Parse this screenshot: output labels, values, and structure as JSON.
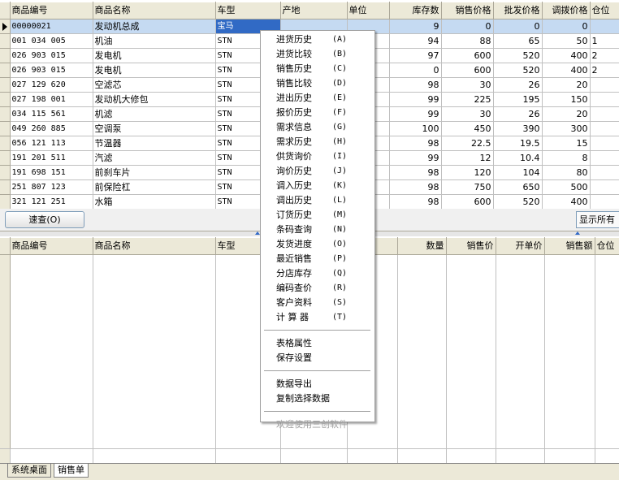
{
  "top_grid": {
    "headers": [
      "商品编号",
      "商品名称",
      "车型",
      "产地",
      "单位",
      "库存数",
      "销售价格",
      "批发价格",
      "调拨价格",
      "仓位"
    ],
    "rows": [
      {
        "code": "00000021",
        "name": "发动机总成",
        "model": "宝马",
        "origin": "",
        "unit": "",
        "stock": "9",
        "sale": "0",
        "wholesale": "0",
        "transfer": "0",
        "bin": ""
      },
      {
        "code": "001 034 005",
        "name": "机油",
        "model": "STN",
        "origin": "",
        "unit": "",
        "stock": "94",
        "sale": "88",
        "wholesale": "65",
        "transfer": "50",
        "bin": "1"
      },
      {
        "code": "026 903 015",
        "name": "发电机",
        "model": "STN",
        "origin": "",
        "unit": "",
        "stock": "97",
        "sale": "600",
        "wholesale": "520",
        "transfer": "400",
        "bin": "2"
      },
      {
        "code": "026 903 015",
        "name": "发电机",
        "model": "STN",
        "origin": "",
        "unit": "",
        "stock": "0",
        "sale": "600",
        "wholesale": "520",
        "transfer": "400",
        "bin": "2"
      },
      {
        "code": "027 129 620",
        "name": "空滤芯",
        "model": "STN",
        "origin": "",
        "unit": "",
        "stock": "98",
        "sale": "30",
        "wholesale": "26",
        "transfer": "20",
        "bin": ""
      },
      {
        "code": "027 198 001",
        "name": "发动机大修包",
        "model": "STN",
        "origin": "",
        "unit": "",
        "stock": "99",
        "sale": "225",
        "wholesale": "195",
        "transfer": "150",
        "bin": ""
      },
      {
        "code": "034 115 561",
        "name": "机滤",
        "model": "STN",
        "origin": "",
        "unit": "",
        "stock": "99",
        "sale": "30",
        "wholesale": "26",
        "transfer": "20",
        "bin": ""
      },
      {
        "code": "049 260 885",
        "name": "空调泵",
        "model": "STN",
        "origin": "",
        "unit": "",
        "stock": "100",
        "sale": "450",
        "wholesale": "390",
        "transfer": "300",
        "bin": ""
      },
      {
        "code": "056 121 113",
        "name": "节温器",
        "model": "STN",
        "origin": "",
        "unit": "",
        "stock": "98",
        "sale": "22.5",
        "wholesale": "19.5",
        "transfer": "15",
        "bin": ""
      },
      {
        "code": "191 201 511",
        "name": "汽滤",
        "model": "STN",
        "origin": "",
        "unit": "",
        "stock": "99",
        "sale": "12",
        "wholesale": "10.4",
        "transfer": "8",
        "bin": ""
      },
      {
        "code": "191 698 151",
        "name": "前刹车片",
        "model": "STN",
        "origin": "",
        "unit": "",
        "stock": "98",
        "sale": "120",
        "wholesale": "104",
        "transfer": "80",
        "bin": ""
      },
      {
        "code": "251 807 123",
        "name": "前保险杠",
        "model": "STN",
        "origin": "",
        "unit": "",
        "stock": "98",
        "sale": "750",
        "wholesale": "650",
        "transfer": "500",
        "bin": ""
      },
      {
        "code": "321 121 251",
        "name": "水箱",
        "model": "STN",
        "origin": "",
        "unit": "",
        "stock": "98",
        "sale": "600",
        "wholesale": "520",
        "transfer": "400",
        "bin": ""
      }
    ]
  },
  "toolbar": {
    "quick_search_label": "速查(O)",
    "show_all_label": "显示所有"
  },
  "bottom_grid": {
    "headers": [
      "商品编号",
      "商品名称",
      "车型",
      "",
      "",
      "数量",
      "销售价",
      "开单价",
      "销售额",
      "仓位"
    ]
  },
  "tabs": [
    {
      "label": "系统桌面",
      "active": false
    },
    {
      "label": "销售单",
      "active": true
    }
  ],
  "context_menu": {
    "groups": [
      [
        {
          "label": "进货历史",
          "accel": "(A)"
        },
        {
          "label": "进货比较",
          "accel": "(B)"
        },
        {
          "label": "销售历史",
          "accel": "(C)"
        },
        {
          "label": "销售比较",
          "accel": "(D)"
        },
        {
          "label": "进出历史",
          "accel": "(E)"
        },
        {
          "label": "报价历史",
          "accel": "(F)"
        },
        {
          "label": "需求信息",
          "accel": "(G)"
        },
        {
          "label": "需求历史",
          "accel": "(H)"
        },
        {
          "label": "供货询价",
          "accel": "(I)"
        },
        {
          "label": "询价历史",
          "accel": "(J)"
        },
        {
          "label": "调入历史",
          "accel": "(K)"
        },
        {
          "label": "调出历史",
          "accel": "(L)"
        },
        {
          "label": "订货历史",
          "accel": "(M)"
        },
        {
          "label": "条码查询",
          "accel": "(N)"
        },
        {
          "label": "发货进度",
          "accel": "(O)"
        },
        {
          "label": "最近销售",
          "accel": "(P)"
        },
        {
          "label": "分店库存",
          "accel": "(Q)"
        },
        {
          "label": "编码查价",
          "accel": "(R)"
        },
        {
          "label": "客户资料",
          "accel": "(S)"
        },
        {
          "label": "计 算 器",
          "accel": "(T)"
        }
      ],
      [
        {
          "label": "表格属性",
          "accel": ""
        },
        {
          "label": "保存设置",
          "accel": ""
        }
      ],
      [
        {
          "label": "数据导出",
          "accel": ""
        },
        {
          "label": "复制选择数据",
          "accel": ""
        }
      ],
      [
        {
          "label": "欢迎使用三创软件",
          "accel": "",
          "disabled": true
        }
      ]
    ]
  },
  "colors": {
    "header_bg": "#ece9d8",
    "selection_row": "#c5daf2",
    "focus_cell": "#316ac5"
  }
}
